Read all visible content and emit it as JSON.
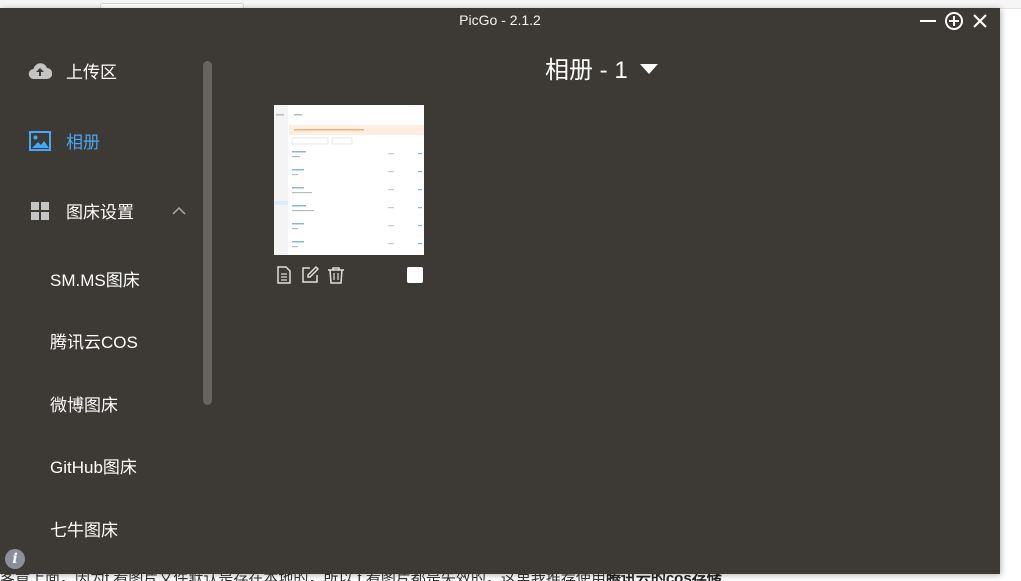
{
  "window": {
    "title": "PicGo - 2.1.2"
  },
  "sidebar": {
    "upload_label": "上传区",
    "album_label": "相册",
    "settings_label": "图床设置",
    "sub_items": [
      "SM.MS图床",
      "腾讯云COS",
      "微博图床",
      "GitHub图床",
      "七牛图床"
    ]
  },
  "main": {
    "album_title": "相册 - 1"
  },
  "background_page": {
    "bottom_text_a": "客章上面，因为t       看图片文件默认是存在本地的，所以 t              看图片都是失效的，这里我推荐使用",
    "bottom_text_b": "腾讯云的cos存储"
  },
  "colors": {
    "window_bg": "#3d3a36",
    "accent": "#46a6f7",
    "text": "#ffffff"
  }
}
